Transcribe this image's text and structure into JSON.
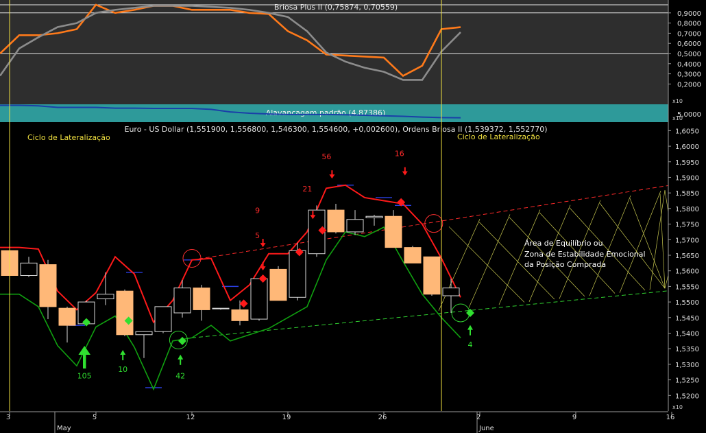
{
  "chart_data": [
    {
      "type": "line",
      "title": "Briosa Plus II (0,75874, 0,70559)",
      "ylim": [
        0.0,
        1.0
      ],
      "y_ticks": [
        "0,9000",
        "0,8000",
        "0,7000",
        "0,6000",
        "0,5000",
        "0,4000",
        "0,3000",
        "0,2000"
      ],
      "y_tick_values": [
        0.9,
        0.8,
        0.7,
        0.6,
        0.5,
        0.4,
        0.3,
        0.2
      ],
      "hlines": [
        0.9,
        0.5
      ],
      "series": [
        {
          "color": "#ff7a1a",
          "values": [
            0.5,
            0.68,
            0.68,
            0.7,
            0.74,
            0.98,
            0.9,
            0.93,
            0.97,
            0.97,
            0.93,
            0.93,
            0.93,
            0.9,
            0.89,
            0.72,
            0.63,
            0.49,
            0.48,
            0.47,
            0.46,
            0.28,
            0.38,
            0.74,
            0.76
          ]
        },
        {
          "color": "#8c8c8c",
          "values": [
            0.28,
            0.55,
            0.66,
            0.76,
            0.8,
            0.9,
            0.93,
            0.95,
            0.97,
            0.97,
            0.97,
            0.96,
            0.95,
            0.93,
            0.9,
            0.86,
            0.72,
            0.51,
            0.42,
            0.36,
            0.32,
            0.24,
            0.24,
            0.52,
            0.71
          ]
        }
      ]
    },
    {
      "type": "line",
      "title": "Alavancagem padrão (4,87386)",
      "y_ticks": [
        "5,0000"
      ],
      "y_unit": "x10",
      "ylim": [
        4.7,
        5.4
      ],
      "series": [
        {
          "color": "#1a3fa8",
          "values": [
            5.36,
            5.36,
            5.34,
            5.28,
            5.28,
            5.28,
            5.25,
            5.25,
            5.24,
            5.24,
            5.24,
            5.2,
            5.1,
            5.05,
            5.02,
            5.0,
            5.0,
            5.0,
            4.99,
            4.97,
            4.95,
            4.93,
            4.9,
            4.88,
            4.87
          ]
        }
      ]
    },
    {
      "type": "candlestick",
      "title": "Euro - US Dollar (1,551900, 1,556800, 1,546300, 1,554600, +0,002600), Ordens Briosa II (1,539372, 1,552770)",
      "ylim": [
        1.515,
        1.6075
      ],
      "y_unit": "x10",
      "y_ticks": [
        "1,6050",
        "1,6000",
        "1,5950",
        "1,5900",
        "1,5850",
        "1,5800",
        "1,5750",
        "1,5700",
        "1,5650",
        "1,5600",
        "1,5550",
        "1,5500",
        "1,5450",
        "1,5400",
        "1,5350",
        "1,5300",
        "1,5250",
        "1,5200"
      ],
      "y_tick_values": [
        1.605,
        1.6,
        1.595,
        1.59,
        1.585,
        1.58,
        1.575,
        1.57,
        1.565,
        1.56,
        1.555,
        1.55,
        1.545,
        1.54,
        1.535,
        1.53,
        1.525,
        1.52
      ],
      "x_ticks": [
        "3",
        "5",
        "12",
        "19",
        "26",
        "2",
        "9",
        "16"
      ],
      "x_tick_index": [
        0,
        4.5,
        9.5,
        14.5,
        19.5,
        24.5,
        29.5,
        34.5
      ],
      "months": [
        "May",
        "June"
      ],
      "month_index": [
        2.5,
        24.5
      ],
      "candles": [
        {
          "open": 1.5665,
          "high": 1.567,
          "low": 1.558,
          "close": 1.5585
        },
        {
          "open": 1.5585,
          "high": 1.5645,
          "low": 1.558,
          "close": 1.5625
        },
        {
          "open": 1.562,
          "high": 1.5635,
          "low": 1.5445,
          "close": 1.5485
        },
        {
          "open": 1.548,
          "high": 1.5485,
          "low": 1.537,
          "close": 1.5425
        },
        {
          "open": 1.543,
          "high": 1.5505,
          "low": 1.5425,
          "close": 1.55
        },
        {
          "open": 1.551,
          "high": 1.5595,
          "low": 1.549,
          "close": 1.5525
        },
        {
          "open": 1.5535,
          "high": 1.554,
          "low": 1.539,
          "close": 1.5395
        },
        {
          "open": 1.5395,
          "high": 1.54,
          "low": 1.532,
          "close": 1.5405
        },
        {
          "open": 1.5405,
          "high": 1.5485,
          "low": 1.54,
          "close": 1.5485
        },
        {
          "open": 1.5465,
          "high": 1.557,
          "low": 1.545,
          "close": 1.5545
        },
        {
          "open": 1.5545,
          "high": 1.5555,
          "low": 1.544,
          "close": 1.5475
        },
        {
          "open": 1.548,
          "high": 1.548,
          "low": 1.5475,
          "close": 1.548
        },
        {
          "open": 1.5475,
          "high": 1.5505,
          "low": 1.5425,
          "close": 1.544
        },
        {
          "open": 1.5445,
          "high": 1.5575,
          "low": 1.544,
          "close": 1.5575
        },
        {
          "open": 1.5605,
          "high": 1.5615,
          "low": 1.551,
          "close": 1.5505
        },
        {
          "open": 1.5515,
          "high": 1.569,
          "low": 1.5505,
          "close": 1.5665
        },
        {
          "open": 1.5655,
          "high": 1.581,
          "low": 1.5645,
          "close": 1.5795
        },
        {
          "open": 1.5795,
          "high": 1.5815,
          "low": 1.572,
          "close": 1.5725
        },
        {
          "open": 1.5725,
          "high": 1.5795,
          "low": 1.5715,
          "close": 1.5765
        },
        {
          "open": 1.577,
          "high": 1.578,
          "low": 1.5745,
          "close": 1.5775
        },
        {
          "open": 1.5775,
          "high": 1.5795,
          "low": 1.5675,
          "close": 1.5675
        },
        {
          "open": 1.5675,
          "high": 1.568,
          "low": 1.5625,
          "close": 1.5625
        },
        {
          "open": 1.5645,
          "high": 1.5645,
          "low": 1.552,
          "close": 1.5525
        },
        {
          "open": 1.552,
          "high": 1.5575,
          "low": 1.5465,
          "close": 1.5545
        }
      ],
      "series": [
        {
          "color": "#ff1a1a",
          "values": [
            1.5675,
            1.5675,
            1.567,
            1.5535,
            1.5475,
            1.553,
            1.5645,
            1.559,
            1.5435,
            1.5505,
            1.5635,
            1.564,
            1.5505,
            1.5555,
            1.5655,
            1.5655,
            1.5725,
            1.5865,
            1.5875,
            1.5835,
            1.5825,
            1.5815,
            1.575,
            1.564,
            1.5515
          ]
        },
        {
          "color": "#10a010",
          "values": [
            1.5525,
            1.5525,
            1.5485,
            1.536,
            1.5295,
            1.542,
            1.5455,
            1.5355,
            1.522,
            1.5375,
            1.5385,
            1.5425,
            1.5375,
            1.5395,
            1.5415,
            1.545,
            1.5485,
            1.5635,
            1.5725,
            1.571,
            1.574,
            1.563,
            1.5525,
            1.545,
            1.5385
          ]
        }
      ],
      "sell_markers": [
        {
          "index": 12.2,
          "value": 1.5495
        },
        {
          "index": 13.2,
          "value": 1.5575
        },
        {
          "index": 15.1,
          "value": 1.566
        },
        {
          "index": 16.3,
          "value": 1.573
        },
        {
          "index": 20.4,
          "value": 1.582
        }
      ],
      "buy_markers": [
        {
          "index": 4.0,
          "value": 1.5435
        },
        {
          "index": 6.2,
          "value": 1.544
        },
        {
          "index": 9.0,
          "value": 1.5375
        },
        {
          "index": 24.0,
          "value": 1.5465
        }
      ],
      "down_arrows": [
        {
          "label": "5",
          "index": 13.2,
          "label_value": 1.5705,
          "arrow_value": 1.5685
        },
        {
          "label": "9",
          "index": 13.2,
          "label_value": 1.5785,
          "arrow_value": 1.561
        },
        {
          "label": "21",
          "index": 15.8,
          "label_value": 1.5855,
          "arrow_value": 1.5775
        },
        {
          "label": "56",
          "index": 16.8,
          "label_value": 1.5958,
          "arrow_value": 1.5905
        },
        {
          "label": "16",
          "index": 20.6,
          "label_value": 1.5968,
          "arrow_value": 1.5915
        }
      ],
      "up_arrows": [
        {
          "label": "105",
          "index": 3.9,
          "label_value": 1.5255,
          "arrow_value": 1.5335,
          "big": true
        },
        {
          "label": "10",
          "index": 5.9,
          "label_value": 1.5275,
          "arrow_value": 1.5335,
          "big": false
        },
        {
          "label": "42",
          "index": 8.9,
          "label_value": 1.5255,
          "arrow_value": 1.532,
          "big": false
        },
        {
          "label": "4",
          "index": 24.0,
          "label_value": 1.5355,
          "arrow_value": 1.5415,
          "big": false
        }
      ],
      "annotations": {
        "left": "Ciclo de Lateralização",
        "right": "Ciclo de Lateralização",
        "zone_lines": [
          "Área de Equilíbrio ou",
          "Zona de Estabilidade Emocional",
          "da Posição Comprada"
        ]
      },
      "trend_upper": [
        [
          9.5,
          1.5635
        ],
        [
          35.5,
          1.5885
        ]
      ],
      "trend_lower": [
        [
          9.5,
          1.5385
        ],
        [
          35.5,
          1.5543
        ]
      ],
      "cycle_lines": [
        0.0,
        22.5
      ],
      "circles": [
        {
          "index": 9.5,
          "value": 1.564
        },
        {
          "index": 8.8,
          "value": 1.5378
        },
        {
          "index": 22.1,
          "value": 1.5752
        },
        {
          "index": 23.5,
          "value": 1.5465
        }
      ]
    }
  ]
}
